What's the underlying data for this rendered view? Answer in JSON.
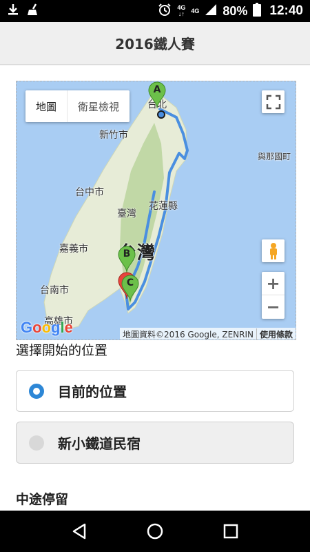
{
  "status_bar": {
    "network_1": "4G",
    "network_2": "4G",
    "battery": "80%",
    "time": "12:40"
  },
  "header": {
    "title": "2016鐵人賽"
  },
  "map": {
    "type_map": "地圖",
    "type_satellite": "衛星檢視",
    "labels": {
      "taipei": "台北",
      "hsinchu": "新竹市",
      "yonaguni": "與那國町",
      "taichung": "台中市",
      "taiwan_small": "臺灣",
      "hualien": "花蓮縣",
      "chiayi": "嘉義市",
      "taiwan_big": "台灣",
      "tainan": "台南市",
      "kaohsiung": "高雄市"
    },
    "markers": {
      "a": "A",
      "b": "B",
      "c": "C"
    },
    "zoom_in": "+",
    "zoom_out": "−",
    "logo": "Google",
    "attribution": "地圖資料©2016 Google, ZENRIN",
    "terms": "使用條款",
    "route_color": "#4a8fe0",
    "marker_color": "#6cc04a"
  },
  "start_section": {
    "label": "選擇開始的位置",
    "options": [
      {
        "label": "目前的位置",
        "selected": true
      },
      {
        "label": "新小鐵道民宿",
        "selected": false
      }
    ]
  },
  "stops": {
    "heading": "中途停留"
  }
}
